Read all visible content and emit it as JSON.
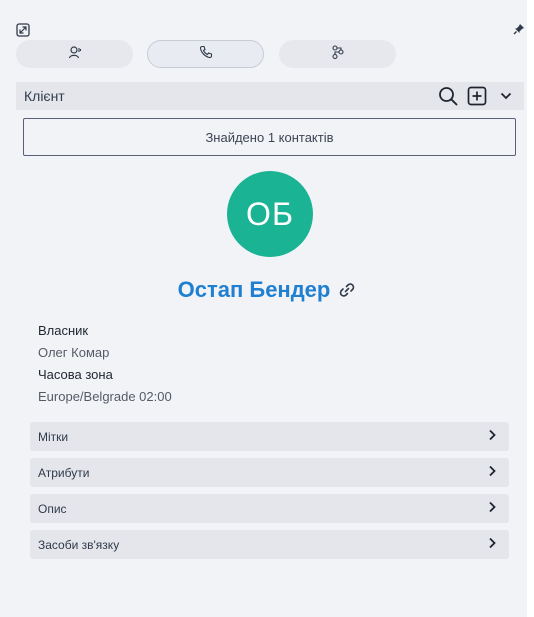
{
  "header": {
    "expand_icon": "expand-icon",
    "pin_icon": "pin-icon"
  },
  "tabs": [
    {
      "icon": "agent-icon",
      "active": false
    },
    {
      "icon": "phone-icon",
      "active": true
    },
    {
      "icon": "workflow-icon",
      "active": false
    }
  ],
  "search": {
    "label": "Клієнт",
    "icons": [
      "search-icon",
      "add-box-icon",
      "chevron-down-icon"
    ]
  },
  "results": {
    "found_text": "Знайдено 1 контактів"
  },
  "contact": {
    "initials": "ОБ",
    "name": "Остап Бендер",
    "avatar_color": "#1ab394",
    "name_color": "#1f7fd1"
  },
  "info": {
    "owner_label": "Власник",
    "owner_value": "Олег Комар",
    "timezone_label": "Часова зона",
    "timezone_value": "Europe/Belgrade 02:00"
  },
  "sections": [
    {
      "label": "Мітки"
    },
    {
      "label": "Атрибути"
    },
    {
      "label": "Опис"
    },
    {
      "label": "Засоби зв'язку"
    }
  ]
}
